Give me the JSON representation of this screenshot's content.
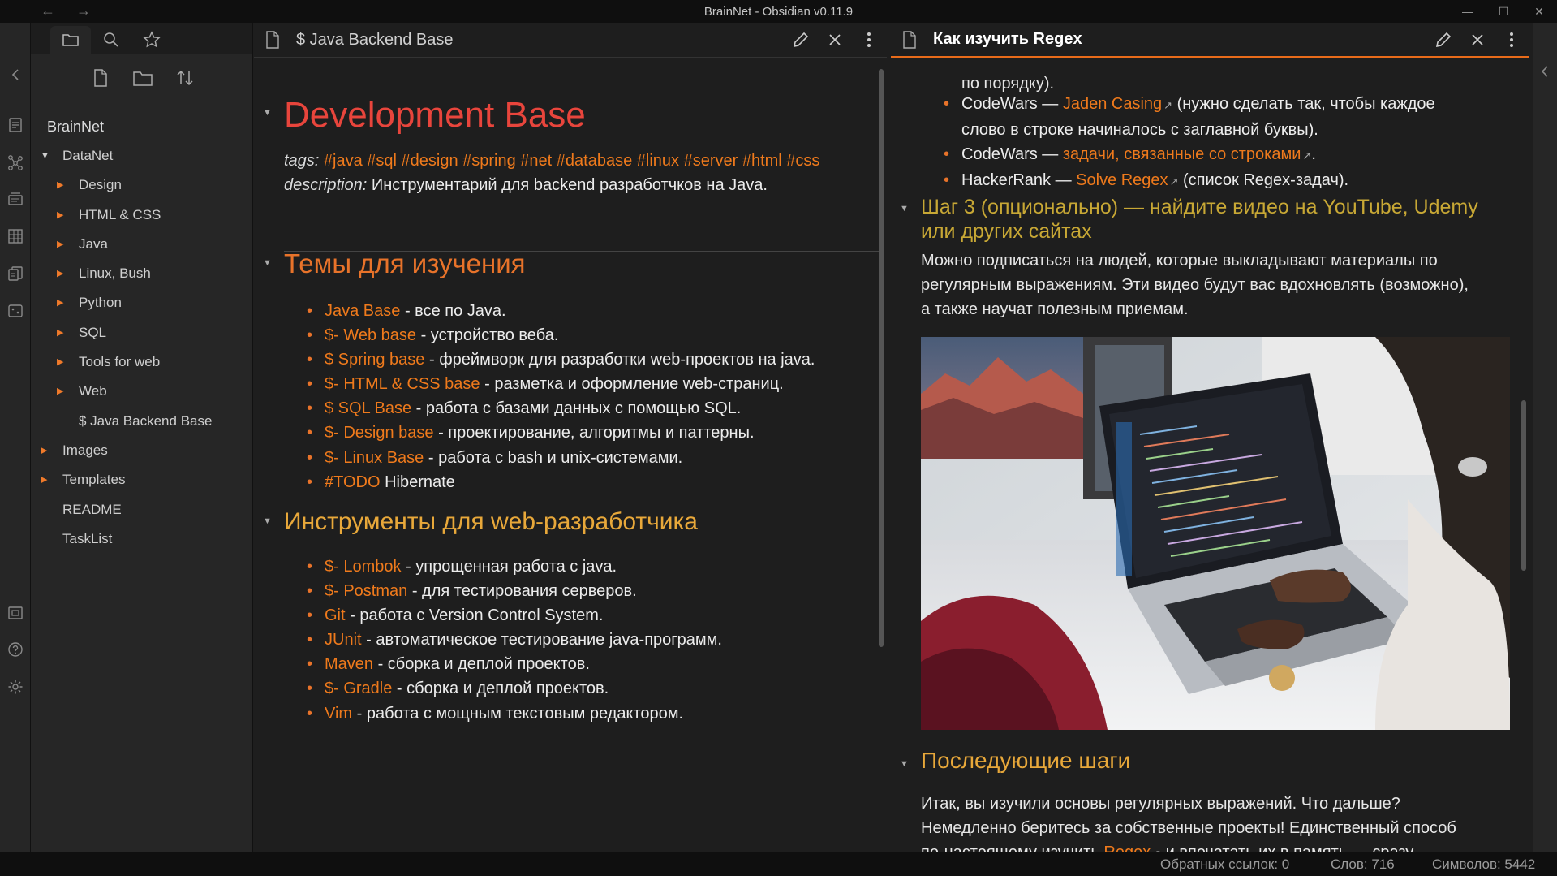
{
  "window": {
    "title": "BrainNet - Obsidian v0.11.9"
  },
  "sidebar": {
    "vault": "BrainNet",
    "tree": [
      {
        "label": "DataNet",
        "type": "folder-open",
        "depth": 0
      },
      {
        "label": "Design",
        "type": "folder",
        "depth": 1
      },
      {
        "label": "HTML & CSS",
        "type": "folder",
        "depth": 1
      },
      {
        "label": "Java",
        "type": "folder",
        "depth": 1
      },
      {
        "label": "Linux, Bush",
        "type": "folder",
        "depth": 1
      },
      {
        "label": "Python",
        "type": "folder",
        "depth": 1
      },
      {
        "label": "SQL",
        "type": "folder",
        "depth": 1
      },
      {
        "label": "Tools for web",
        "type": "folder",
        "depth": 1
      },
      {
        "label": "Web",
        "type": "folder",
        "depth": 1
      },
      {
        "label": "$ Java Backend Base",
        "type": "file",
        "depth": 1
      },
      {
        "label": "Images",
        "type": "folder",
        "depth": 0
      },
      {
        "label": "Templates",
        "type": "folder",
        "depth": 0
      },
      {
        "label": "README",
        "type": "file",
        "depth": 0
      },
      {
        "label": "TaskList",
        "type": "file",
        "depth": 0
      }
    ]
  },
  "left_pane": {
    "title": "$ Java Backend Base",
    "h1": "Development Base",
    "tags_label": "tags:",
    "tags": "#java #sql #design #spring #net #database #linux #server #html #css",
    "desc_label": "description:",
    "desc": " Инструментарий для backend разработчков на Java.",
    "sec1_title": "Темы для изучения",
    "sec1_items": [
      {
        "link": "Java Base",
        "text": " - все по Java."
      },
      {
        "link": "$- Web base",
        "text": " - устройство веба."
      },
      {
        "link": "$ Spring base",
        "text": " - фреймворк для разработки web-проектов на java."
      },
      {
        "link": "$- HTML & CSS base",
        "text": " - разметка и оформление web-страниц."
      },
      {
        "link": "$ SQL Base",
        "text": " - работа с базами данных с помощью SQL."
      },
      {
        "link": "$- Design base",
        "text": " - проектирование, алгоритмы и паттерны."
      },
      {
        "link": "$- Linux Base",
        "text": " - работа с bash и unix-системами."
      },
      {
        "link": "#TODO",
        "text": " Hibernate"
      }
    ],
    "sec2_title": "Инструменты для web-разработчика",
    "sec2_items": [
      {
        "link": "$- Lombok",
        "text": " - упрощенная работа с java."
      },
      {
        "link": "$- Postman",
        "text": " - для тестирования серверов."
      },
      {
        "link": "Git",
        "text": " - работа с Version Control System."
      },
      {
        "link": "JUnit",
        "text": " - автоматическое тестирование java-программ."
      },
      {
        "link": "Maven",
        "text": " - сборка и деплой проектов."
      },
      {
        "link": "$- Gradle",
        "text": " - сборка и деплой проектов."
      },
      {
        "link": "Vim",
        "text": " - работа с мощным текстовым редактором."
      }
    ]
  },
  "right_pane": {
    "title": "Как изучить Regex",
    "top_fragment": "по порядку).",
    "list": {
      "i1_pre": "CodeWars — ",
      "i1_link": "Jaden Casing",
      "i1_post": " (нужно сделать так, чтобы каждое",
      "i1_line2": "слово в строке начиналось с заглавной буквы).",
      "i2_pre": "CodeWars — ",
      "i2_link": "задачи, связанные со строками",
      "i2_post": ".",
      "i3_pre": "HackerRank — ",
      "i3_link": "Solve Regex",
      "i3_post": " (список Regex-задач)."
    },
    "step3_line1": "Шаг 3 (опционально) — найдите видео на YouTube, Udemy",
    "step3_line2": "или других сайтах",
    "step3_para": [
      "Можно подписаться на людей, которые выкладывают материалы по",
      "регулярным выражениям. Эти видео будут вас вдохновлять (возможно),",
      "а также научат полезным приемам."
    ],
    "next_title": "Последующие шаги",
    "next_para_1": "Итак, вы изучили основы регулярных выражений. Что дальше?",
    "next_para_2": "Немедленно беритесь за собственные проекты! Единственный способ",
    "next_para_3_pre": "по-настоящему изучить ",
    "next_para_3_link": "Regex",
    "next_para_3_post": " и впечатать их в память — сразу"
  },
  "status": {
    "backlinks": "Обратных ссылок: 0",
    "words": "Слов: 716",
    "chars": "Символов: 5442"
  },
  "colors": {
    "accent": "#ef7a1c",
    "heading_red": "#e8453c",
    "heading_orange": "#e8732a",
    "heading_amber": "#e8a83a"
  }
}
